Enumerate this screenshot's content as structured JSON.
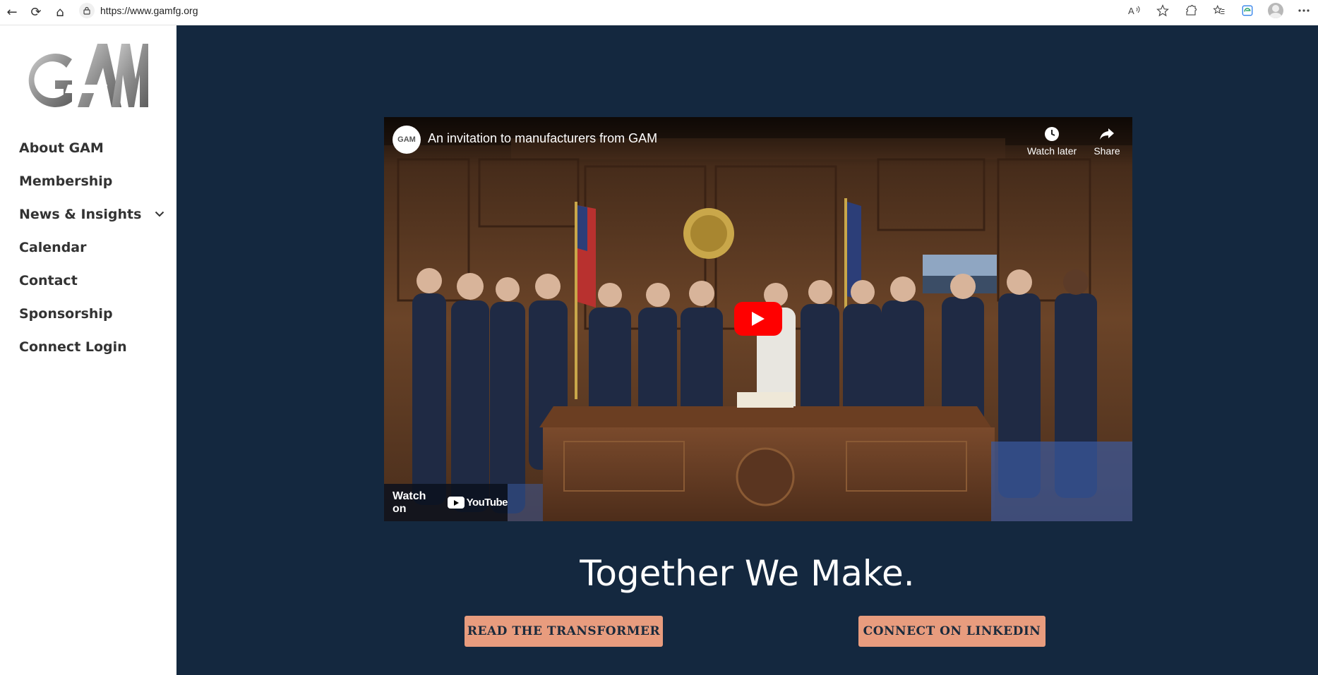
{
  "browser": {
    "url": "https://www.gamfg.org",
    "back_glyph": "←",
    "reload_glyph": "⟳",
    "home_glyph": "⌂",
    "right_icons": [
      "read-aloud-icon",
      "favorite-star-icon",
      "extensions-icon",
      "favorites-icon",
      "edge-icon",
      "profile-avatar",
      "more-menu-icon"
    ]
  },
  "sidebar": {
    "logo_text": "GAM",
    "menu": [
      {
        "label": "About GAM"
      },
      {
        "label": "Membership"
      },
      {
        "label": "News & Insights",
        "has_submenu": true
      },
      {
        "label": "Calendar"
      },
      {
        "label": "Contact"
      },
      {
        "label": "Sponsorship"
      },
      {
        "label": "Connect Login"
      }
    ]
  },
  "video": {
    "channel_badge": "GAM",
    "title": "An invitation to manufacturers from GAM",
    "watch_later": "Watch later",
    "share": "Share",
    "watch_on": "Watch on",
    "youtube": "YouTube"
  },
  "hero": {
    "tagline": "Together We Make.",
    "buttons": [
      "READ THE TRANSFORMER",
      "CONNECT ON LINKEDIN"
    ]
  },
  "colors": {
    "main_bg": "#14283f",
    "button_bg": "#e89c7e",
    "menu_text": "#333333",
    "youtube_red": "#ff0000"
  }
}
